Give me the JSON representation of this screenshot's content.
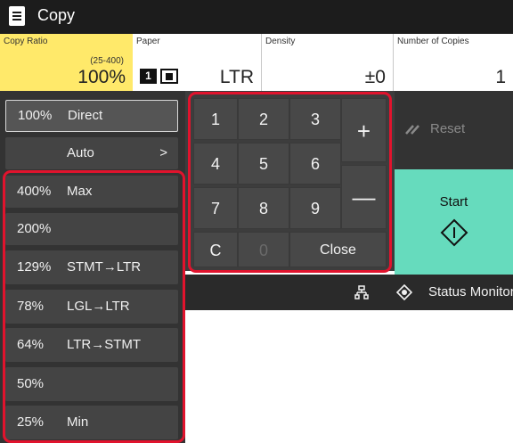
{
  "title_bar": {
    "title": "Copy",
    "icon": "copy-document-icon"
  },
  "settings": {
    "copy_ratio": {
      "label": "Copy Ratio",
      "range": "(25-400)",
      "value": "100%"
    },
    "paper": {
      "label": "Paper",
      "tray": "1",
      "tray_icon": "paper-drawer-icon",
      "value": "LTR"
    },
    "density": {
      "label": "Density",
      "value": "±0"
    },
    "copies": {
      "label": "Number of Copies",
      "value": "1"
    }
  },
  "ratio_menu": {
    "direct": {
      "percent": "100%",
      "label": "Direct"
    },
    "auto": {
      "label": "Auto",
      "chevron": ">"
    },
    "presets": [
      {
        "percent": "400%",
        "label": "Max"
      },
      {
        "percent": "200%",
        "label": ""
      },
      {
        "percent": "129%",
        "label": "STMT→LTR"
      },
      {
        "percent": "78%",
        "label": "LGL→LTR"
      },
      {
        "percent": "64%",
        "label": "LTR→STMT"
      },
      {
        "percent": "50%",
        "label": ""
      },
      {
        "percent": "25%",
        "label": "Min"
      }
    ]
  },
  "keypad": {
    "digits": [
      "1",
      "2",
      "3",
      "4",
      "5",
      "6",
      "7",
      "8",
      "9"
    ],
    "plus": "+",
    "minus": "—",
    "clear": "C",
    "zero": "0",
    "close": "Close"
  },
  "actions": {
    "reset": "Reset",
    "reset_icon": "reset-slash-icon",
    "start": "Start",
    "start_icon": "start-diamond-icon"
  },
  "status": {
    "network_icon": "network-icon",
    "monitor_icon": "status-monitor-icon",
    "monitor_label": "Status Monitor"
  },
  "colors": {
    "copy_ratio_bg": "#ffe96a",
    "start_bg": "#66dbbd",
    "highlight": "#e1132d",
    "panel_dark": "#333333"
  }
}
